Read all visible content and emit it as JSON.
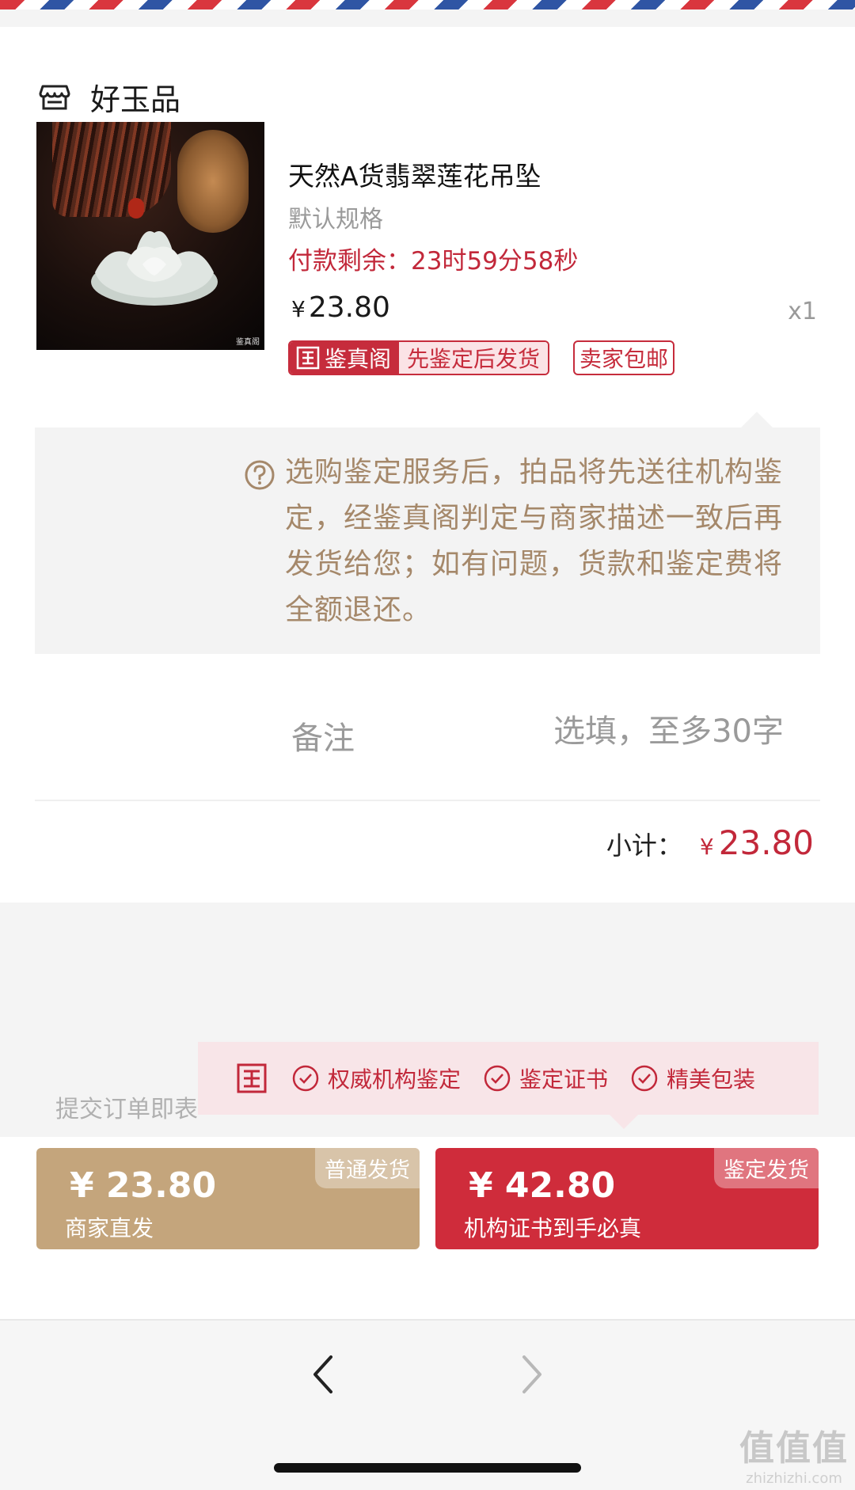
{
  "shop": {
    "name": "好玉品",
    "icon": "store-icon"
  },
  "product": {
    "title": "天然A货翡翠莲花吊坠",
    "spec": "默认规格",
    "countdown": "付款剩余：23时59分58秒",
    "currency": "¥",
    "price": "23.80",
    "quantity": "x1",
    "badge_auth_brand": "鉴真阁",
    "badge_auth_text": "先鉴定后发货",
    "badge_shipping": "卖家包邮",
    "image_watermark": "鉴真阁"
  },
  "notice": {
    "icon": "help-circle-icon",
    "text": "选购鉴定服务后，拍品将先送往机构鉴定，经鉴真阁判定与商家描述一致后再发货给您；如有问题，货款和鉴定费将全额退还。"
  },
  "remark": {
    "label": "备注",
    "placeholder": "选填，至多30字"
  },
  "subtotal": {
    "label": "小计：",
    "currency": "¥",
    "value": "23.80"
  },
  "agreement_text": "提交订单即表",
  "promo_banner": {
    "items": [
      "权威机构鉴定",
      "鉴定证书",
      "精美包装"
    ]
  },
  "options": {
    "normal": {
      "tag": "普通发货",
      "price": "¥ 23.80",
      "subtitle": "商家直发"
    },
    "authenticated": {
      "tag": "鉴定发货",
      "price": "¥ 42.80",
      "subtitle": "机构证书到手必真"
    }
  },
  "nav": {
    "back": "chevron-left-icon",
    "forward": "chevron-right-icon"
  },
  "watermark": {
    "big": "值值值",
    "small": "zhizhizhi.com"
  },
  "colors": {
    "accent_red": "#c2283a",
    "gold": "#c4a57c",
    "notice_text": "#a5886a"
  }
}
